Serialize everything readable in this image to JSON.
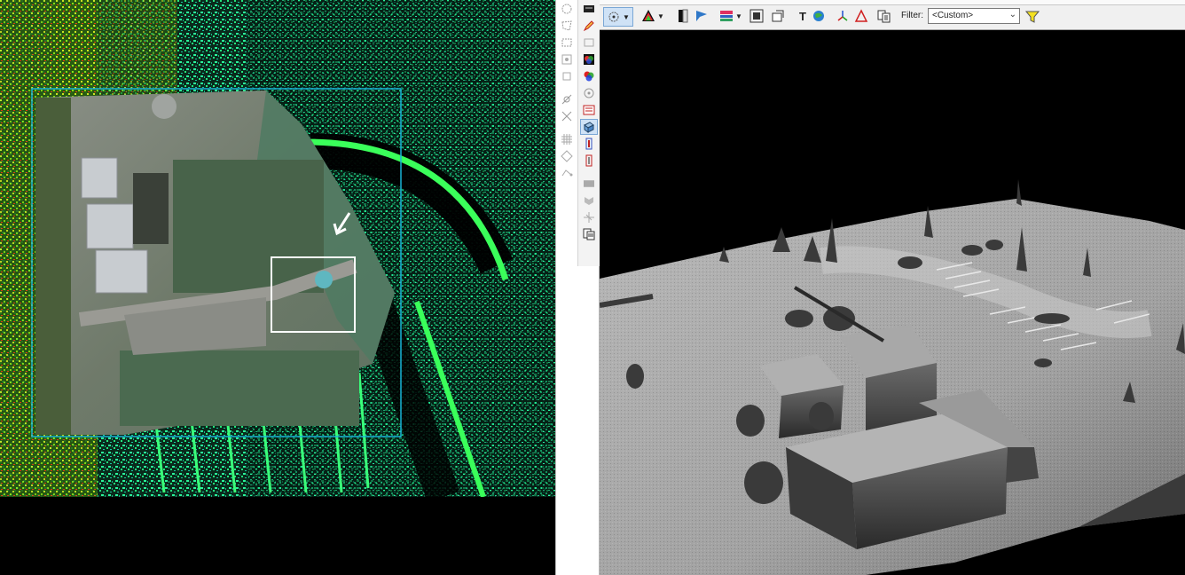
{
  "left_view": {
    "name": "2D map view",
    "annotation_arrow": "arrow-icon"
  },
  "vertical_toolbar": {
    "left_column_icons": [
      "select-cloud-icon",
      "select-polygon-icon",
      "select-area-icon",
      "zoom-cloud-icon",
      "zoom-area-icon",
      "measure-icon",
      "grid-icon",
      "diamond-icon",
      "route-icon"
    ],
    "right_column_icons": [
      "display-icon",
      "edit-icon",
      "swatch-icon",
      "color-wheel-icon",
      "rgb-icon",
      "info-icon",
      "layers-icon",
      "cube-icon",
      "profile-icon",
      "section-icon",
      "pattern-icon",
      "shield-icon",
      "axis-icon",
      "report-icon"
    ]
  },
  "toolbar": {
    "filter_label": "Filter:",
    "filter_value": "<Custom>"
  },
  "colors": {
    "points_green": "#1ed67a",
    "points_cyan": "#26f0c0",
    "selection_cyan": "#19b3d6",
    "toolbar_bg": "#f0f0f0"
  }
}
